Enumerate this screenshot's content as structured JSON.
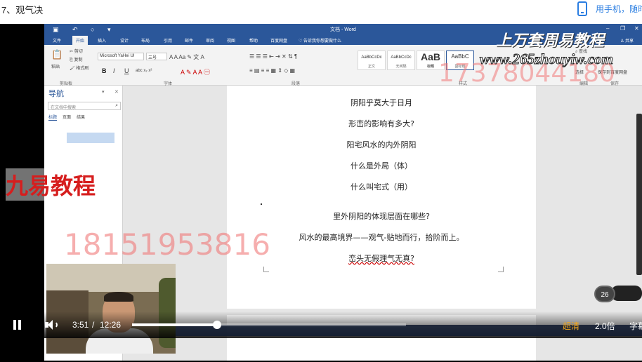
{
  "page": {
    "lesson_title": "7、观气决",
    "phone_link": "用手机，随时"
  },
  "word": {
    "doc_title": "文档 - Word",
    "tabs": [
      "文件",
      "开始",
      "插入",
      "设计",
      "布局",
      "引用",
      "邮件",
      "审阅",
      "视图",
      "帮助",
      "百度网盘"
    ],
    "tell_me": "告诉我你想要做什么",
    "share": "共享",
    "ribbon": {
      "paste": "粘贴",
      "cut": "剪切",
      "copy": "复制",
      "format_painter": "格式刷",
      "font_name": "Microsoft YaHei UI",
      "font_size": "三号",
      "styles": [
        {
          "sample": "AaBbCcDc",
          "name": "正文"
        },
        {
          "sample": "AaBbCcDc",
          "name": "无间隔"
        },
        {
          "sample": "AaB",
          "name": "标题"
        },
        {
          "sample": "AaBbC",
          "name": "副标题"
        }
      ],
      "find": "查找",
      "select": "选择",
      "save_baidu": "保存到百度网盘",
      "groups": {
        "clipboard": "剪贴板",
        "font": "字体",
        "paragraph": "段落",
        "styles": "样式",
        "edit": "编辑",
        "save": "保存"
      }
    },
    "nav": {
      "title": "导航",
      "search_placeholder": "在文档中搜索",
      "tabs": [
        "标题",
        "页面",
        "结果"
      ]
    },
    "doc_lines": [
      "阴阳乎莫大于日月",
      "形峦的影响有多大?",
      "阳宅风水的内外阴阳",
      "什么是外局（体）",
      "什么叫宅式（用）",
      "里外阴阳的体现层面在哪些?",
      "风水的最高境界——观气-贴地而行，拾阶而上。",
      "峦头无假理气无真?"
    ]
  },
  "watermarks": {
    "brand": "上万套周易教程",
    "url": "www.265zhouyiw.com",
    "phone1": "17378044180",
    "jiuyi": "九易教程",
    "phone2": "18151953816"
  },
  "player": {
    "current_time": "3:51",
    "separator": "/",
    "total_time": "12:26",
    "progress_fraction": 0.31,
    "quality": "超清",
    "speed": "2.0倍",
    "subtitle": "字幕",
    "speed_badge": "26"
  },
  "colors": {
    "word_blue": "#2b579a",
    "link_blue": "#2a7de1",
    "quality_orange": "#f4a81d",
    "watermark_red": "#d61e1e"
  }
}
